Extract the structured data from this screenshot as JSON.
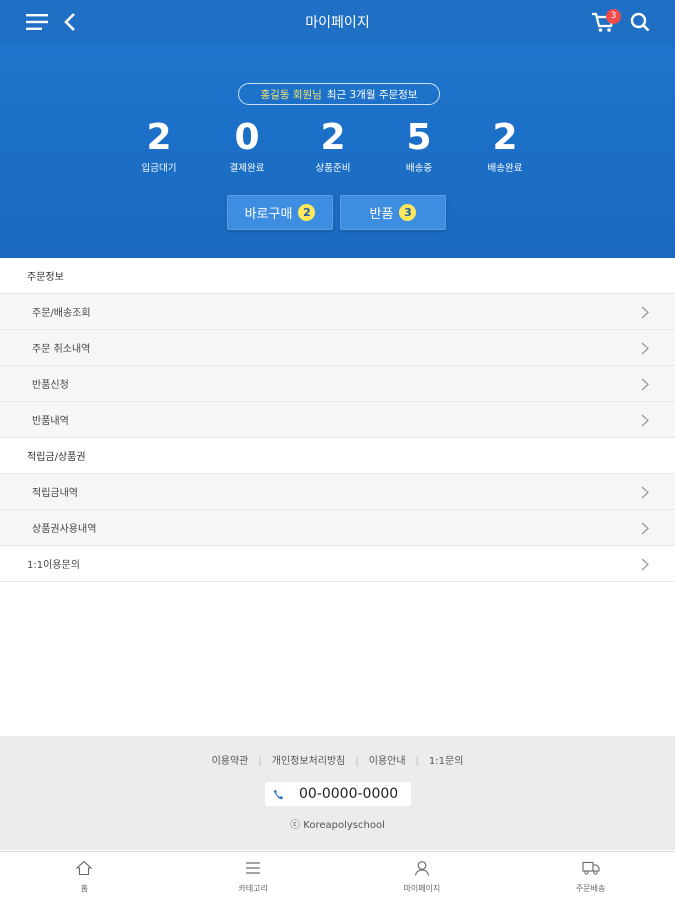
{
  "header": {
    "title": "마이페이지",
    "cart_count": "3",
    "icons": [
      "menu-icon",
      "back-icon",
      "cart-icon",
      "search-icon"
    ]
  },
  "summary": {
    "user_name": "홍길동 회원님",
    "period_text": "최근 3개월 주문정보",
    "counts": [
      {
        "value": "2",
        "label": "입금대기"
      },
      {
        "value": "0",
        "label": "결제완료"
      },
      {
        "value": "2",
        "label": "상품준비"
      },
      {
        "value": "5",
        "label": "배송중"
      },
      {
        "value": "2",
        "label": "배송완료"
      }
    ],
    "buttons": [
      {
        "label": "바로구매",
        "count": "2"
      },
      {
        "label": "반품",
        "count": "3"
      }
    ]
  },
  "sections": {
    "order_info": {
      "title": "주문정보",
      "items": [
        "주문/배송조회",
        "주문 취소내역",
        "반품신청",
        "반품내역"
      ]
    },
    "points": {
      "title": "적립금/상품권",
      "items": [
        "적립금내역",
        "상품권사용내역"
      ]
    },
    "inquiry": "1:1이용문의"
  },
  "footer": {
    "links": [
      "이용약관",
      "개인정보처리방침",
      "이용안내",
      "1:1문의"
    ],
    "phone": "00-0000-0000",
    "copyright": "ⓒ Koreapolyschool"
  },
  "bottom_nav": [
    {
      "label": "홈",
      "icon": "home-icon"
    },
    {
      "label": "카테고리",
      "icon": "category-icon"
    },
    {
      "label": "마이페이지",
      "icon": "user-icon"
    },
    {
      "label": "주문배송",
      "icon": "truck-icon"
    }
  ],
  "colors": {
    "header_bg": "#1f6fc4",
    "summary_bg": "#1e74cc",
    "badge_yellow": "#ffe85c",
    "cart_badge": "#f04a4a"
  }
}
